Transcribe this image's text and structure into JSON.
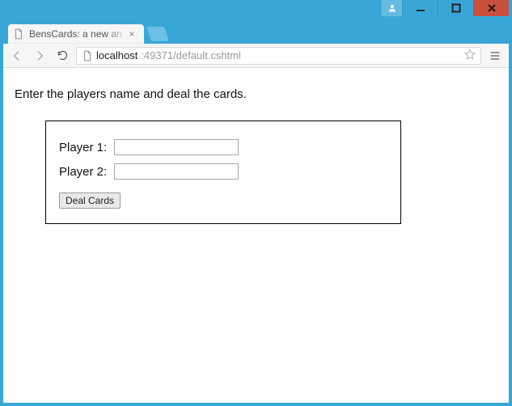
{
  "window": {
    "user_icon": "user-icon",
    "minimize": "minimize-icon",
    "maximize": "maximize-icon",
    "close": "close-icon"
  },
  "tab": {
    "title": "BensCards: a new an",
    "favicon": "document-icon"
  },
  "address": {
    "host": "localhost",
    "rest": ":49371/default.cshtml"
  },
  "page": {
    "prompt": "Enter the players name and deal the cards.",
    "player1_label": "Player 1:",
    "player2_label": "Player 2:",
    "player1_value": "",
    "player2_value": "",
    "deal_button": "Deal Cards"
  }
}
